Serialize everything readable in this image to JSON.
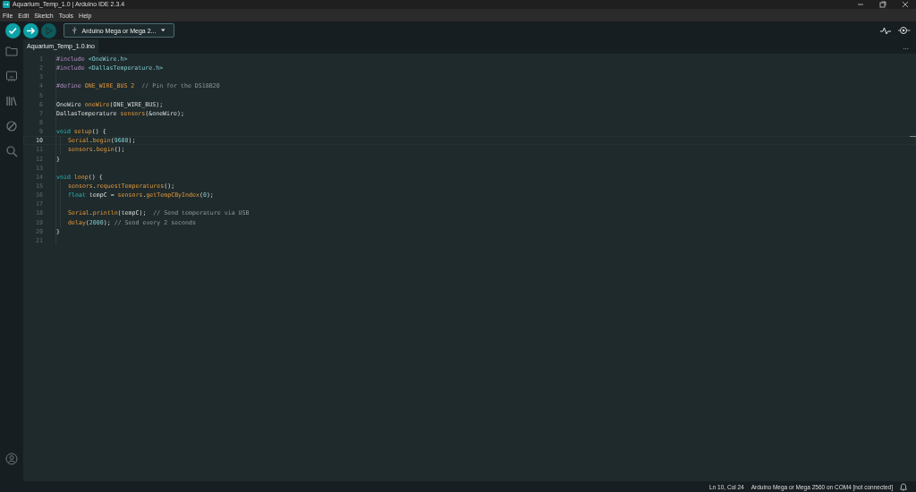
{
  "window": {
    "title": "Aquarium_Temp_1.0 | Arduino IDE 2.3.4"
  },
  "menu": [
    "File",
    "Edit",
    "Sketch",
    "Tools",
    "Help"
  ],
  "toolbar": {
    "buttons": [
      {
        "kind": "verify",
        "disabled": false
      },
      {
        "kind": "upload",
        "disabled": false
      },
      {
        "kind": "debug",
        "disabled": true
      }
    ],
    "board": "Arduino Mega or Mega 2..."
  },
  "sidebar": {
    "items": [
      {
        "kind": "folder",
        "selected": false
      },
      {
        "kind": "board",
        "selected": false
      },
      {
        "kind": "library",
        "selected": false
      },
      {
        "kind": "debug",
        "selected": false
      },
      {
        "kind": "search",
        "selected": false
      }
    ]
  },
  "tabs": [
    {
      "label": "Aquarium_Temp_1.0.ino",
      "selected": true
    }
  ],
  "tab_menu": "...",
  "editor": {
    "lines": [
      {
        "number": "1",
        "current": false,
        "indented": false,
        "tokens": [
          {
            "t": "#include ",
            "kind": "directive"
          },
          {
            "t": "<OneWire.h>",
            "kind": "string"
          }
        ]
      },
      {
        "number": "2",
        "current": false,
        "indented": false,
        "tokens": [
          {
            "t": "#include ",
            "kind": "directive"
          },
          {
            "t": "<DallasTemperature.h>",
            "kind": "string"
          }
        ]
      },
      {
        "number": "3",
        "current": false,
        "indented": false
      },
      {
        "number": "4",
        "current": false,
        "indented": false,
        "tokens": [
          {
            "t": "#define ",
            "kind": "directive"
          },
          {
            "t": "ONE_WIRE_BUS 2",
            "kind": "func"
          },
          {
            "t": "  // Pin for the DS18B20",
            "kind": "comment"
          }
        ]
      },
      {
        "number": "5",
        "current": false,
        "indented": false
      },
      {
        "number": "6",
        "current": false,
        "indented": false,
        "tokens": [
          {
            "t": "OneWire ",
            "kind": "plain"
          },
          {
            "t": "oneWire",
            "kind": "func"
          },
          {
            "t": "(ONE_WIRE_BUS);",
            "kind": "plain"
          }
        ]
      },
      {
        "number": "7",
        "current": false,
        "indented": false,
        "tokens": [
          {
            "t": "DallasTemperature ",
            "kind": "plain"
          },
          {
            "t": "sensors",
            "kind": "func"
          },
          {
            "t": "(&oneWire);",
            "kind": "plain"
          }
        ]
      },
      {
        "number": "8",
        "current": false,
        "indented": false
      },
      {
        "number": "9",
        "current": false,
        "indented": false,
        "tokens": [
          {
            "t": "void ",
            "kind": "keyword"
          },
          {
            "t": "setup",
            "kind": "func"
          },
          {
            "t": "() {",
            "kind": "plain"
          }
        ]
      },
      {
        "number": "10",
        "current": true,
        "indented": true,
        "tokens": [
          {
            "t": "Serial",
            "kind": "func"
          },
          {
            "t": ".",
            "kind": "plain"
          },
          {
            "t": "begin",
            "kind": "func"
          },
          {
            "t": "(",
            "kind": "plain"
          },
          {
            "t": "9600",
            "kind": "number"
          },
          {
            "t": ");",
            "kind": "plain"
          }
        ]
      },
      {
        "number": "11",
        "current": false,
        "indented": true,
        "tokens": [
          {
            "t": "sensors",
            "kind": "func"
          },
          {
            "t": ".",
            "kind": "plain"
          },
          {
            "t": "begin",
            "kind": "func"
          },
          {
            "t": "();",
            "kind": "plain"
          }
        ]
      },
      {
        "number": "12",
        "current": false,
        "indented": false,
        "tokens": [
          {
            "t": "}",
            "kind": "plain"
          }
        ]
      },
      {
        "number": "13",
        "current": false,
        "indented": false
      },
      {
        "number": "14",
        "current": false,
        "indented": false,
        "tokens": [
          {
            "t": "void ",
            "kind": "keyword"
          },
          {
            "t": "loop",
            "kind": "func"
          },
          {
            "t": "() {",
            "kind": "plain"
          }
        ]
      },
      {
        "number": "15",
        "current": false,
        "indented": true,
        "tokens": [
          {
            "t": "sensors",
            "kind": "func"
          },
          {
            "t": ".",
            "kind": "plain"
          },
          {
            "t": "requestTemperatures",
            "kind": "func"
          },
          {
            "t": "();",
            "kind": "plain"
          }
        ]
      },
      {
        "number": "16",
        "current": false,
        "indented": true,
        "tokens": [
          {
            "t": "float ",
            "kind": "keyword"
          },
          {
            "t": "tempC = ",
            "kind": "plain"
          },
          {
            "t": "sensors",
            "kind": "func"
          },
          {
            "t": ".",
            "kind": "plain"
          },
          {
            "t": "getTempCByIndex",
            "kind": "func"
          },
          {
            "t": "(",
            "kind": "plain"
          },
          {
            "t": "0",
            "kind": "number"
          },
          {
            "t": ");",
            "kind": "plain"
          }
        ]
      },
      {
        "number": "17",
        "current": false,
        "indented": true
      },
      {
        "number": "18",
        "current": false,
        "indented": true,
        "tokens": [
          {
            "t": "Serial",
            "kind": "func"
          },
          {
            "t": ".",
            "kind": "plain"
          },
          {
            "t": "println",
            "kind": "func"
          },
          {
            "t": "(tempC);",
            "kind": "plain"
          },
          {
            "t": "  // Send temperature via USB",
            "kind": "comment"
          }
        ]
      },
      {
        "number": "19",
        "current": false,
        "indented": true,
        "tokens": [
          {
            "t": "delay",
            "kind": "func"
          },
          {
            "t": "(",
            "kind": "plain"
          },
          {
            "t": "2000",
            "kind": "number"
          },
          {
            "t": ");",
            "kind": "plain"
          },
          {
            "t": " // Send every 2 seconds",
            "kind": "comment"
          }
        ]
      },
      {
        "number": "20",
        "current": false,
        "indented": false,
        "tokens": [
          {
            "t": "}",
            "kind": "plain"
          }
        ]
      },
      {
        "number": "21",
        "current": false,
        "indented": false
      }
    ]
  },
  "status_bar": {
    "position": "Ln 10, Col 24",
    "board": "Arduino Mega or Mega 2560 on COM4 [not connected]"
  }
}
